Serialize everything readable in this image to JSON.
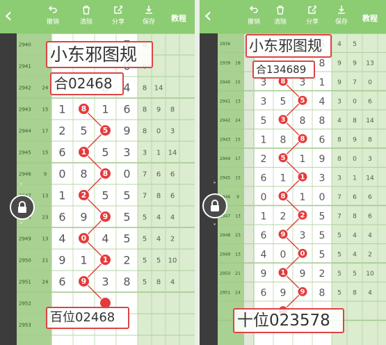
{
  "toolbar": {
    "undo_label": "撤销",
    "clear_label": "清除",
    "share_label": "分享",
    "save_label": "保存",
    "help_label": "教程"
  },
  "colors": {
    "toolbar": "#8ccc72",
    "grid_green": "#a4cf8c",
    "ball_red": "#e33b3b",
    "annotation_border": "#d44444"
  },
  "left_panel": {
    "overlay_title": "小东邪图规",
    "overlay_sum": "合02468",
    "overlay_bottom": "百位02468",
    "rows": [
      {
        "issue": "2940",
        "sum": "",
        "d": [
          "",
          "",
          "",
          "7",
          "0"
        ],
        "ball": -1
      },
      {
        "issue": "2941",
        "sum": "",
        "d": [
          "",
          "",
          "",
          "0",
          "6"
        ],
        "ball": -1
      },
      {
        "issue": "2942",
        "sum": "24",
        "d": [
          "",
          "",
          "8",
          "4",
          "8",
          "14"
        ],
        "ball": -1
      },
      {
        "issue": "2943",
        "sum": "15",
        "d": [
          "1",
          "8",
          "1",
          "6",
          "8",
          "9",
          "8"
        ],
        "ball": 1
      },
      {
        "issue": "2944",
        "sum": "17",
        "d": [
          "2",
          "5",
          "1",
          "9",
          "8",
          "0",
          "3"
        ],
        "ball": 1
      },
      {
        "issue": "2945",
        "sum": "15",
        "d": [
          "6",
          "1",
          "5",
          "3",
          "3",
          "1",
          "14"
        ],
        "ball": 1
      },
      {
        "issue": "2946",
        "sum": "9",
        "d": [
          "0",
          "8",
          "1",
          "0",
          "7",
          "6",
          "6"
        ],
        "ball": 1
      },
      {
        "issue": "2947",
        "sum": "13",
        "d": [
          "1",
          "2",
          "5",
          "5",
          "7",
          "8",
          "6"
        ],
        "ball": 1
      },
      {
        "issue": "2948",
        "sum": "23",
        "d": [
          "6",
          "9",
          "3",
          "5",
          "5",
          "4",
          "4"
        ],
        "ball": 1
      },
      {
        "issue": "2949",
        "sum": "13",
        "d": [
          "4",
          "0",
          "4",
          "5",
          "5",
          "4",
          "2"
        ],
        "ball": 1
      },
      {
        "issue": "2950",
        "sum": "21",
        "d": [
          "9",
          "1",
          "9",
          "2",
          "5",
          "5",
          "10"
        ],
        "ball": 1
      },
      {
        "issue": "2951",
        "sum": "24",
        "d": [
          "6",
          "9",
          "3",
          "8",
          "5",
          "8",
          "4"
        ],
        "ball": 1
      },
      {
        "issue": "2952",
        "sum": "",
        "d": [],
        "ball": 1
      },
      {
        "issue": "2953",
        "sum": "",
        "d": [],
        "ball": -1
      },
      {
        "issue": "",
        "sum": "",
        "d": [],
        "ball": -1
      }
    ]
  },
  "right_panel": {
    "overlay_title": "小东邪图规",
    "overlay_sum": "合134689",
    "overlay_bottom": "十位023578",
    "rows": [
      {
        "issue": "2936",
        "sum": "",
        "d": [
          "",
          "",
          "",
          "6",
          "4",
          "5"
        ],
        "ball": -1
      },
      {
        "issue": "2939",
        "sum": "18",
        "d": [
          "",
          "",
          "",
          "8",
          "9",
          "9",
          "13"
        ],
        "ball": -1
      },
      {
        "issue": "2940",
        "sum": "15",
        "d": [
          "3",
          "8",
          "3",
          "1",
          "9",
          "7",
          "0"
        ],
        "ball": 1
      },
      {
        "issue": "2941",
        "sum": "13",
        "d": [
          "3",
          "5",
          "1",
          "4",
          "3",
          "0",
          "6"
        ],
        "ball": 1
      },
      {
        "issue": "2942",
        "sum": "24",
        "d": [
          "5",
          "3",
          "8",
          "8",
          "4",
          "8",
          "14"
        ],
        "ball": 1
      },
      {
        "issue": "2943",
        "sum": "15",
        "d": [
          "1",
          "8",
          "1",
          "6",
          "8",
          "9",
          "8"
        ],
        "ball": 1
      },
      {
        "issue": "2944",
        "sum": "17",
        "d": [
          "2",
          "5",
          "1",
          "9",
          "8",
          "0",
          "3"
        ],
        "ball": 1
      },
      {
        "issue": "2945",
        "sum": "15",
        "d": [
          "6",
          "1",
          "5",
          "3",
          "3",
          "1",
          "14"
        ],
        "ball": 1
      },
      {
        "issue": "2946",
        "sum": "9",
        "d": [
          "0",
          "8",
          "1",
          "0",
          "7",
          "6",
          "6"
        ],
        "ball": 1
      },
      {
        "issue": "2947",
        "sum": "13",
        "d": [
          "1",
          "2",
          "5",
          "5",
          "7",
          "8",
          "6"
        ],
        "ball": 1
      },
      {
        "issue": "2948",
        "sum": "23",
        "d": [
          "6",
          "9",
          "3",
          "5",
          "5",
          "4",
          "4"
        ],
        "ball": 1
      },
      {
        "issue": "2949",
        "sum": "13",
        "d": [
          "4",
          "0",
          "4",
          "5",
          "5",
          "4",
          "2"
        ],
        "ball": 1
      },
      {
        "issue": "2950",
        "sum": "21",
        "d": [
          "9",
          "1",
          "9",
          "2",
          "5",
          "5",
          "10"
        ],
        "ball": 1
      },
      {
        "issue": "2951",
        "sum": "24",
        "d": [
          "6",
          "9",
          "3",
          "8",
          "5",
          "8",
          "4"
        ],
        "ball": 1
      },
      {
        "issue": "",
        "sum": "",
        "d": [],
        "ball": 1
      },
      {
        "issue": "",
        "sum": "",
        "d": [],
        "ball": -1
      }
    ]
  }
}
